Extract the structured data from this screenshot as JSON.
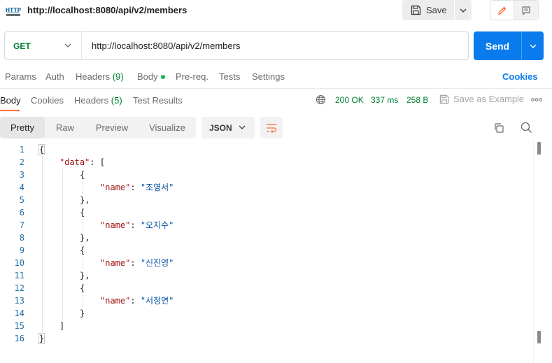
{
  "request": {
    "title": "http://localhost:8080/api/v2/members",
    "method": "GET",
    "url": "http://localhost:8080/api/v2/members",
    "icon_label": "HTTP"
  },
  "toolbar": {
    "save_label": "Save",
    "send_label": "Send"
  },
  "request_tabs": [
    {
      "label": "Params"
    },
    {
      "label": "Auth"
    },
    {
      "label": "Headers",
      "count": "(9)"
    },
    {
      "label": "Body"
    },
    {
      "label": "Pre-req."
    },
    {
      "label": "Tests"
    },
    {
      "label": "Settings"
    }
  ],
  "cookies_link": "Cookies",
  "response_tabs": [
    {
      "label": "Body"
    },
    {
      "label": "Cookies"
    },
    {
      "label": "Headers",
      "count": "(5)"
    },
    {
      "label": "Test Results"
    }
  ],
  "status": {
    "code": "200 OK",
    "time": "337 ms",
    "size": "258 B"
  },
  "save_example_label": "Save as Example",
  "view_modes": [
    "Pretty",
    "Raw",
    "Preview",
    "Visualize"
  ],
  "format": "JSON",
  "colors": {
    "accent": "#ff6c37",
    "send": "#097bed",
    "method_get": "#007f31",
    "status_ok": "#007f31",
    "json_key": "#a31515",
    "json_string": "#0451a5",
    "line_number": "#1f6fa8"
  },
  "response_body": {
    "lines": [
      {
        "n": "1",
        "parts": [
          {
            "t": "{",
            "c": "punct"
          }
        ]
      },
      {
        "n": "2",
        "parts": [
          {
            "t": "\"data\"",
            "c": "key"
          },
          {
            "t": ": [",
            "c": "punct"
          }
        ]
      },
      {
        "n": "3",
        "parts": [
          {
            "t": "{",
            "c": "punct"
          }
        ]
      },
      {
        "n": "4",
        "parts": [
          {
            "t": "\"name\"",
            "c": "key"
          },
          {
            "t": ": ",
            "c": "punct"
          },
          {
            "t": "\"조영서\"",
            "c": "str"
          }
        ]
      },
      {
        "n": "5",
        "parts": [
          {
            "t": "},",
            "c": "punct"
          }
        ]
      },
      {
        "n": "6",
        "parts": [
          {
            "t": "{",
            "c": "punct"
          }
        ]
      },
      {
        "n": "7",
        "parts": [
          {
            "t": "\"name\"",
            "c": "key"
          },
          {
            "t": ": ",
            "c": "punct"
          },
          {
            "t": "\"오지수\"",
            "c": "str"
          }
        ]
      },
      {
        "n": "8",
        "parts": [
          {
            "t": "},",
            "c": "punct"
          }
        ]
      },
      {
        "n": "9",
        "parts": [
          {
            "t": "{",
            "c": "punct"
          }
        ]
      },
      {
        "n": "10",
        "parts": [
          {
            "t": "\"name\"",
            "c": "key"
          },
          {
            "t": ": ",
            "c": "punct"
          },
          {
            "t": "\"신진영\"",
            "c": "str"
          }
        ]
      },
      {
        "n": "11",
        "parts": [
          {
            "t": "},",
            "c": "punct"
          }
        ]
      },
      {
        "n": "12",
        "parts": [
          {
            "t": "{",
            "c": "punct"
          }
        ]
      },
      {
        "n": "13",
        "parts": [
          {
            "t": "\"name\"",
            "c": "key"
          },
          {
            "t": ": ",
            "c": "punct"
          },
          {
            "t": "\"서정연\"",
            "c": "str"
          }
        ]
      },
      {
        "n": "14",
        "parts": [
          {
            "t": "}",
            "c": "punct"
          }
        ]
      },
      {
        "n": "15",
        "parts": [
          {
            "t": "]",
            "c": "punct"
          }
        ]
      },
      {
        "n": "16",
        "parts": [
          {
            "t": "}",
            "c": "punct"
          }
        ]
      }
    ]
  }
}
